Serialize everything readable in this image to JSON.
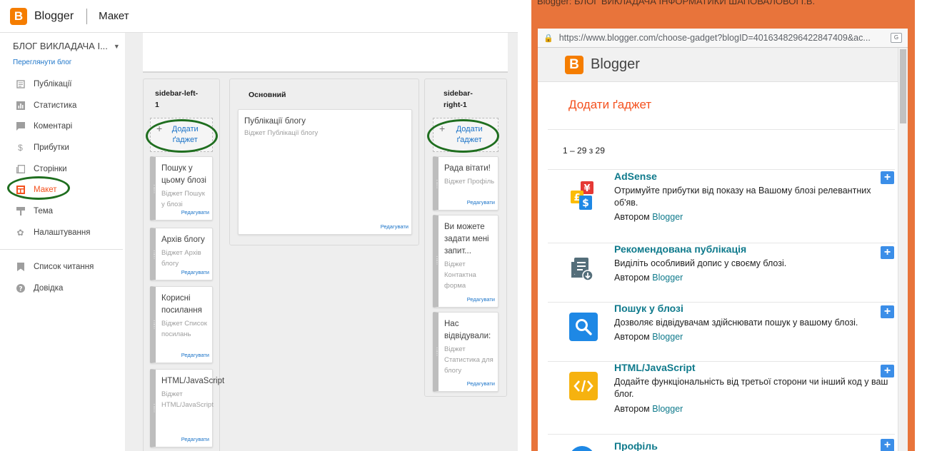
{
  "left": {
    "brand": "Blogger",
    "page_title": "Макет",
    "blog_name": "БЛОГ ВИКЛАДАЧА І...",
    "view_blog": "Переглянути блог",
    "nav": [
      {
        "label": "Публікації",
        "icon": "posts-icon"
      },
      {
        "label": "Статистика",
        "icon": "stats-icon"
      },
      {
        "label": "Коментарі",
        "icon": "comments-icon"
      },
      {
        "label": "Прибутки",
        "icon": "earnings-icon"
      },
      {
        "label": "Сторінки",
        "icon": "pages-icon"
      },
      {
        "label": "Макет",
        "icon": "layout-icon",
        "active": true
      },
      {
        "label": "Тема",
        "icon": "theme-icon"
      },
      {
        "label": "Налаштування",
        "icon": "settings-icon"
      }
    ],
    "nav_bottom": [
      {
        "label": "Список читання",
        "icon": "bookmark-icon"
      },
      {
        "label": "Довідка",
        "icon": "help-icon"
      }
    ],
    "columns": {
      "sidebar_left": {
        "title": "sidebar-left-1",
        "add": "Додати ґаджет",
        "gadgets": [
          {
            "title": "Пошук у цьому блозі",
            "sub": "Віджет Пошук у блозі",
            "edit": "Редагувати"
          },
          {
            "title": "Архів блогу",
            "sub": "Віджет Архів блогу",
            "edit": "Редагувати"
          },
          {
            "title": "Корисні посилання",
            "sub": "Віджет Список посилань",
            "edit": "Редагувати"
          },
          {
            "title": "HTML/JavaScript",
            "sub": "Віджет HTML/JavaScript",
            "edit": "Редагувати"
          }
        ]
      },
      "main": {
        "title": "Основний",
        "gadgets": [
          {
            "title": "Публікації блогу",
            "sub": "Віджет Публікації блогу",
            "edit": "Редагувати"
          }
        ]
      },
      "sidebar_right": {
        "title": "sidebar-right-1",
        "add": "Додати ґаджет",
        "gadgets": [
          {
            "title": "Рада вітати!",
            "sub": "Віджет Профіль",
            "edit": "Редагувати"
          },
          {
            "title": "Ви можете задати мені запит...",
            "sub": "Віджет Контактна форма",
            "edit": "Редагувати"
          },
          {
            "title": "Нас відвідували:",
            "sub": "Віджет Статистика для блогу",
            "edit": "Редагувати"
          }
        ]
      }
    }
  },
  "right": {
    "window_title": "Blogger: БЛОГ ВИКЛАДАЧА ІНФОРМАТИКИ ШАПОВАЛОВОЇ І.В.",
    "url": "https://www.blogger.com/choose-gadget?blogID=4016348296422847409&ac...",
    "brand": "Blogger",
    "heading": "Додати ґаджет",
    "count": "1 – 29 з 29",
    "gadgets": [
      {
        "name": "AdSense",
        "desc": "Отримуйте прибутки від показу на Вашому блозі релевантних об'яв.",
        "by_label": "Автором",
        "by": "Blogger",
        "icon": "adsense-icon"
      },
      {
        "name": "Рекомендована публікація",
        "desc": "Виділіть особливий допис у своєму блозі.",
        "by_label": "Автором",
        "by": "Blogger",
        "icon": "featured-post-icon"
      },
      {
        "name": "Пошук у блозі",
        "desc": "Дозволяє відвідувачам здійснювати пошук у вашому блозі.",
        "by_label": "Автором",
        "by": "Blogger",
        "icon": "search-icon"
      },
      {
        "name": "HTML/JavaScript",
        "desc": "Додайте функціональність від третьої сторони чи інший код у ваш блог.",
        "by_label": "Автором",
        "by": "Blogger",
        "icon": "code-icon"
      },
      {
        "name": "Профіль",
        "icon": "profile-icon"
      }
    ],
    "colors": {
      "accent": "#f4511e",
      "link": "#0f7a8c",
      "plus": "#3b8ee8",
      "frame": "#e8743b"
    }
  }
}
